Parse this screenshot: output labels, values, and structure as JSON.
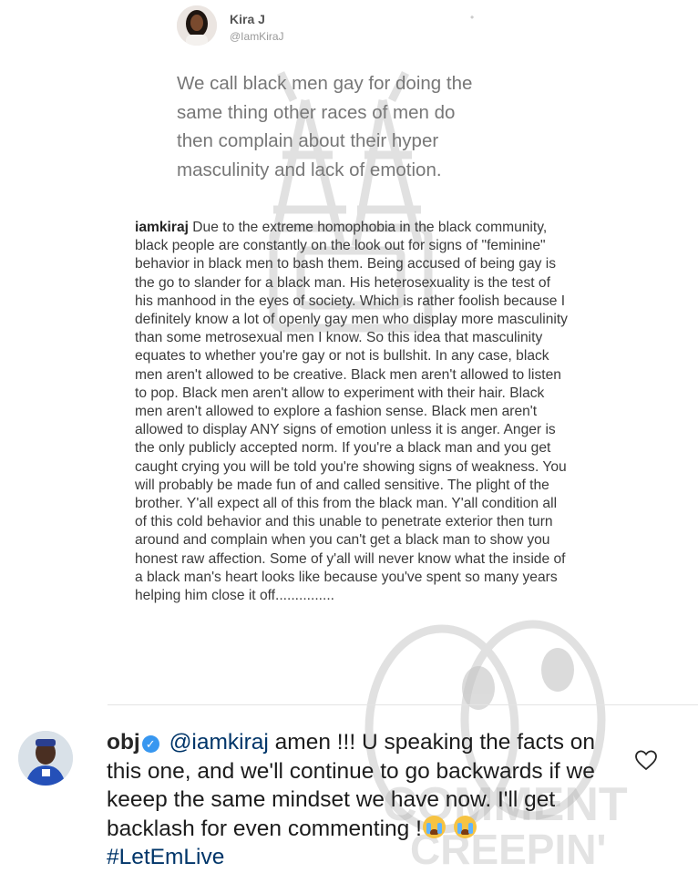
{
  "tweet": {
    "name": "Kira J",
    "handle": "@IamKiraJ",
    "text": "We call black men gay for doing the same thing other races of men do then complain about their hyper masculinity and lack of emotion."
  },
  "caption": {
    "username": "iamkiraj",
    "text": "Due to the extreme homophobia in the black community, black people are constantly on the look out for signs of \"feminine\" behavior in black men to bash them. Being accused of being gay is the go to slander for a black man. His heterosexuality is the test of his manhood in the eyes of society. Which is rather foolish because I definitely know a lot of openly gay men who display more masculinity than some metrosexual men I know. So this idea that masculinity equates to whether you're gay or not is bullshit. In any case, black men aren't allowed to be creative. Black men aren't allowed to listen to pop. Black men aren't allow to experiment with their hair. Black men aren't allowed to explore a fashion sense. Black men aren't allowed to display ANY signs of emotion unless it is anger. Anger is the only publicly accepted norm. If you're a black man and you get caught crying you will be told you're showing signs of weakness. You will probably be made fun of and called sensitive. The plight of the brother. Y'all expect all of this from the black man. Y'all condition all of this cold behavior and this unable to penetrate exterior then turn around and complain when you can't get a black man to show you honest raw affection. Some of y'all will never know what the inside of a black man's heart looks like because you've spent so many years helping him close it off..............."
  },
  "comment": {
    "username": "obj",
    "mention": "@iamkiraj",
    "text": "amen !!! U speaking the facts on this one, and we'll continue to go backwards if we keeep the same mindset we have now. I'll get backlash for even commenting !",
    "hashtag": "#LetEmLive",
    "emojis": [
      "loudly-crying-face",
      "loudly-crying-face"
    ]
  },
  "watermark": {
    "lines": [
      "COMMENT",
      "CREEPIN'"
    ]
  },
  "icons": {
    "verified": "verified-badge-icon",
    "like": "heart-outline-icon"
  },
  "colors": {
    "verified": "#3897f0",
    "link": "#003569",
    "watermark": "#bdbdbd"
  }
}
